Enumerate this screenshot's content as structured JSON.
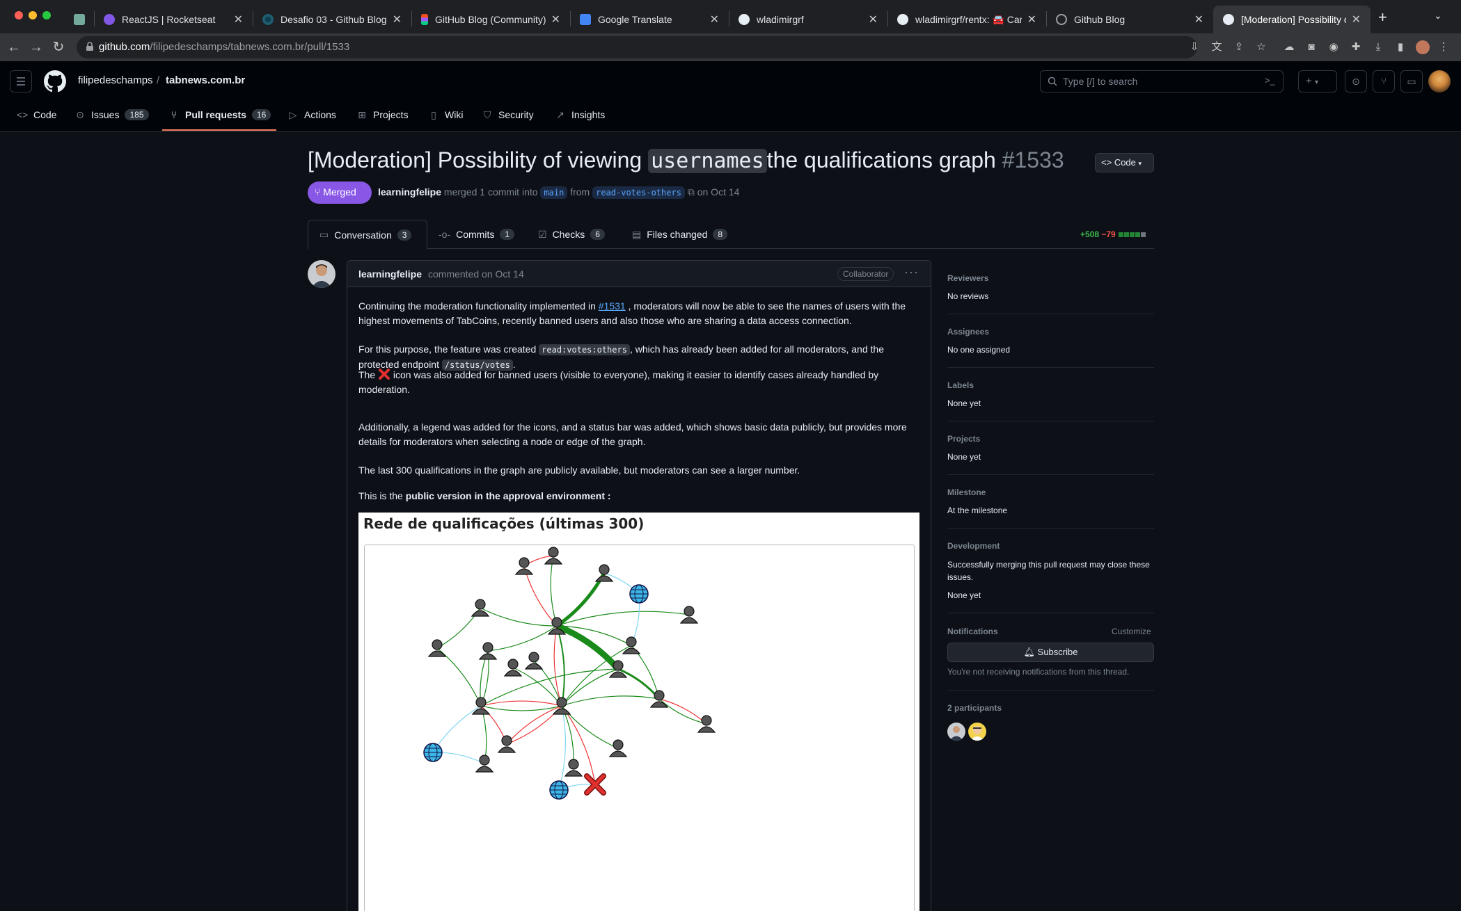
{
  "browser": {
    "tabs": [
      {
        "title": "",
        "favicon": "chatgpt"
      },
      {
        "title": "ReactJS | Rocketseat",
        "favicon": "rocketseat"
      },
      {
        "title": "Desafio 03 - Github Blog",
        "favicon": "circle"
      },
      {
        "title": "GitHub Blog (Community) – F",
        "favicon": "figma"
      },
      {
        "title": "Google Translate",
        "favicon": "translate"
      },
      {
        "title": "wladimirgrf",
        "favicon": "github"
      },
      {
        "title": "wladimirgrf/rentx: 🚘 Car Re",
        "favicon": "github"
      },
      {
        "title": "Github Blog",
        "favicon": "globe"
      },
      {
        "title": "[Moderation] Possibility of s",
        "favicon": "github"
      }
    ],
    "url_domain": "github.com",
    "url_path": "/filipedeschamps/tabnews.com.br/pull/1533"
  },
  "header": {
    "owner": "filipedeschamps",
    "separator": "/",
    "repo": "tabnews.com.br",
    "search_placeholder": "Type [/] to search"
  },
  "repo_nav": [
    {
      "label": "Code",
      "icon": "code-icon"
    },
    {
      "label": "Issues",
      "count": "185",
      "icon": "issue-icon"
    },
    {
      "label": "Pull requests",
      "count": "16",
      "icon": "pr-icon"
    },
    {
      "label": "Actions",
      "icon": "play-icon"
    },
    {
      "label": "Projects",
      "icon": "table-icon"
    },
    {
      "label": "Wiki",
      "icon": "book-icon"
    },
    {
      "label": "Security",
      "icon": "shield-icon"
    },
    {
      "label": "Insights",
      "icon": "graph-icon"
    }
  ],
  "pr": {
    "title_before": "[Moderation] Possibility of viewing",
    "title_code": "usernames",
    "title_after": "the qualifications graph",
    "number": "#1533",
    "code_button": "Code",
    "state": "Merged",
    "author": "learningfelipe",
    "merged_text": "merged 1 commit into",
    "base_branch": "main",
    "from_text": "from",
    "head_branch": "read-votes-others",
    "date": "on Oct 14"
  },
  "pr_tabs": [
    {
      "label": "Conversation",
      "count": "3",
      "icon": "comment-icon"
    },
    {
      "label": "Commits",
      "count": "1",
      "icon": "commit-icon"
    },
    {
      "label": "Checks",
      "count": "6",
      "icon": "checks-icon"
    },
    {
      "label": "Files changed",
      "count": "8",
      "icon": "file-diff-icon"
    }
  ],
  "diffstat": {
    "additions": "+508",
    "deletions": "−79",
    "colors": {
      "add": "#1f6feb",
      "del": "#f0883e",
      "neutral": "#30363d"
    }
  },
  "comment": {
    "author": "learningfelipe",
    "when": "commented on Oct 14",
    "role": "Collaborator",
    "p1_a": "Continuing the moderation functionality implemented in",
    "p1_link": "#1531",
    "p1_b": ", moderators will now be able to see the names of users with the highest movements of TabCoins, recently banned users and also those who are sharing a data access connection.",
    "p2_a": "For this purpose, the feature was created",
    "p2_code1": "read:votes:others",
    "p2_b": ", which has already been added for all moderators, and the protected endpoint",
    "p2_code2": "/status/votes",
    "p2_c": ".",
    "p3_a": "The",
    "p3_b": "icon was also added for banned users (visible to everyone), making it easier to identify cases already handled by moderation.",
    "p4": "Additionally, a legend was added for the icons, and a status bar was added, which shows basic data publicly, but provides more details for moderators when selecting a node or edge of the graph.",
    "p5": "The last 300 qualifications in the graph are publicly available, but moderators can see a larger number.",
    "p6_a": "This is the",
    "p6_b": "public version in the approval environment :",
    "graph_title": "Rede de qualificações (últimas 300)"
  },
  "sidebar": {
    "reviewers_h": "Reviewers",
    "reviewers_v": "No reviews",
    "assignees_h": "Assignees",
    "assignees_v": "No one assigned",
    "labels_h": "Labels",
    "labels_v": "None yet",
    "projects_h": "Projects",
    "projects_v": "None yet",
    "milestone_h": "Milestone",
    "milestone_v": "At the milestone",
    "development_h": "Development",
    "development_note": "Successfully merging this pull request may close these issues.",
    "development_v": "None yet",
    "notifications_h": "Notifications",
    "customize": "Customize",
    "subscribe": "Subscribe",
    "notif_note": "You're not receiving notifications from this thread.",
    "participants_h": "2 participants"
  }
}
